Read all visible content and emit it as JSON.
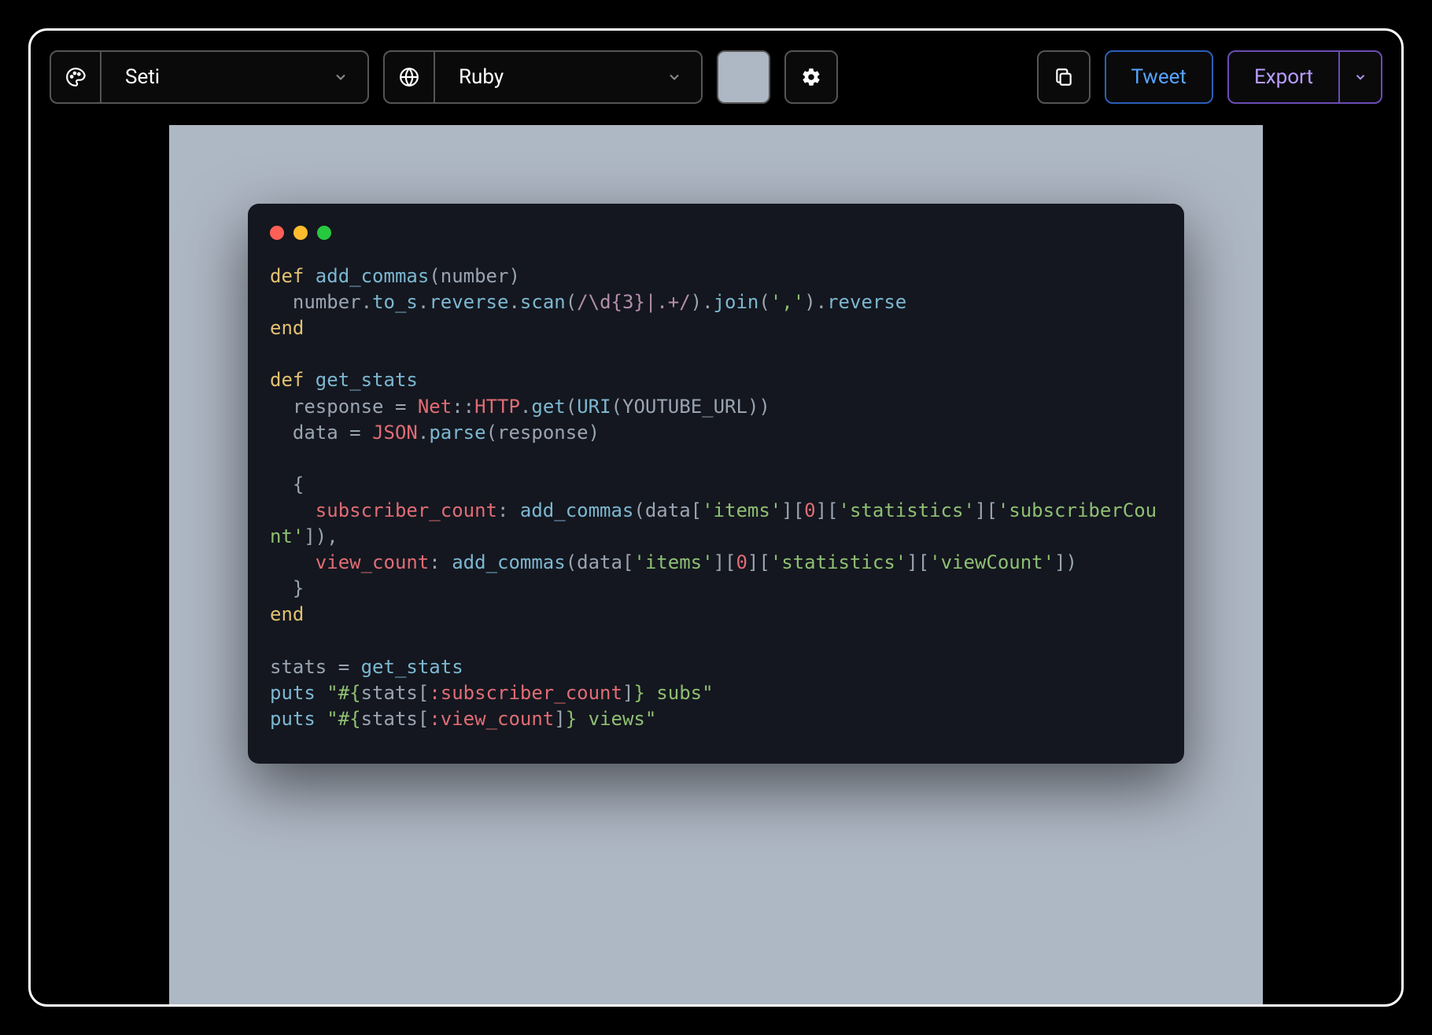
{
  "toolbar": {
    "theme_label": "Seti",
    "language_label": "Ruby",
    "swatch_color": "#aeb7c4",
    "tweet_label": "Tweet",
    "export_label": "Export"
  },
  "window": {
    "traffic_colors": [
      "#ff5f56",
      "#ffbd2e",
      "#27c93f"
    ]
  },
  "code": {
    "tokens": [
      [
        [
          "kw",
          "def "
        ],
        [
          "fn",
          "add_commas"
        ],
        [
          "pun",
          "("
        ],
        [
          "id",
          "number"
        ],
        [
          "pun",
          ")"
        ]
      ],
      [
        [
          "id",
          "  number"
        ],
        [
          "pun",
          "."
        ],
        [
          "call",
          "to_s"
        ],
        [
          "pun",
          "."
        ],
        [
          "call",
          "reverse"
        ],
        [
          "pun",
          "."
        ],
        [
          "call",
          "scan"
        ],
        [
          "pun",
          "("
        ],
        [
          "re",
          "/\\d{3}|.+/"
        ],
        [
          "pun",
          ")."
        ],
        [
          "call",
          "join"
        ],
        [
          "pun",
          "("
        ],
        [
          "str",
          "','"
        ],
        [
          "pun",
          ")."
        ],
        [
          "call",
          "reverse"
        ]
      ],
      [
        [
          "kw",
          "end"
        ]
      ],
      [
        [
          "",
          ""
        ]
      ],
      [
        [
          "kw",
          "def "
        ],
        [
          "fn",
          "get_stats"
        ]
      ],
      [
        [
          "id",
          "  response "
        ],
        [
          "op",
          "= "
        ],
        [
          "cls",
          "Net"
        ],
        [
          "pun",
          "::"
        ],
        [
          "cls",
          "HTTP"
        ],
        [
          "pun",
          "."
        ],
        [
          "call",
          "get"
        ],
        [
          "pun",
          "("
        ],
        [
          "call",
          "URI"
        ],
        [
          "pun",
          "("
        ],
        [
          "const",
          "YOUTUBE_URL"
        ],
        [
          "pun",
          "))"
        ]
      ],
      [
        [
          "id",
          "  data "
        ],
        [
          "op",
          "= "
        ],
        [
          "cls",
          "JSON"
        ],
        [
          "pun",
          "."
        ],
        [
          "call",
          "parse"
        ],
        [
          "pun",
          "("
        ],
        [
          "id",
          "response"
        ],
        [
          "pun",
          ")"
        ]
      ],
      [
        [
          "",
          ""
        ]
      ],
      [
        [
          "pun",
          "  {"
        ]
      ],
      [
        [
          "sym",
          "    subscriber_count"
        ],
        [
          "pun",
          ": "
        ],
        [
          "call",
          "add_commas"
        ],
        [
          "pun",
          "("
        ],
        [
          "id",
          "data"
        ],
        [
          "pun",
          "["
        ],
        [
          "str",
          "'items'"
        ],
        [
          "pun",
          "]["
        ],
        [
          "num",
          "0"
        ],
        [
          "pun",
          "]["
        ],
        [
          "str",
          "'statistics'"
        ],
        [
          "pun",
          "]["
        ],
        [
          "str",
          "'subscriberCount'"
        ],
        [
          "pun",
          "]),"
        ]
      ],
      [
        [
          "sym",
          "    view_count"
        ],
        [
          "pun",
          ": "
        ],
        [
          "call",
          "add_commas"
        ],
        [
          "pun",
          "("
        ],
        [
          "id",
          "data"
        ],
        [
          "pun",
          "["
        ],
        [
          "str",
          "'items'"
        ],
        [
          "pun",
          "]["
        ],
        [
          "num",
          "0"
        ],
        [
          "pun",
          "]["
        ],
        [
          "str",
          "'statistics'"
        ],
        [
          "pun",
          "]["
        ],
        [
          "str",
          "'viewCount'"
        ],
        [
          "pun",
          "])"
        ]
      ],
      [
        [
          "pun",
          "  }"
        ]
      ],
      [
        [
          "kw",
          "end"
        ]
      ],
      [
        [
          "",
          ""
        ]
      ],
      [
        [
          "id",
          "stats "
        ],
        [
          "op",
          "= "
        ],
        [
          "call",
          "get_stats"
        ]
      ],
      [
        [
          "call",
          "puts "
        ],
        [
          "str",
          "\"#{"
        ],
        [
          "id",
          "stats"
        ],
        [
          "pun",
          "["
        ],
        [
          "sym",
          ":subscriber_count"
        ],
        [
          "pun",
          "]"
        ],
        [
          "str",
          "} subs\""
        ]
      ],
      [
        [
          "call",
          "puts "
        ],
        [
          "str",
          "\"#{"
        ],
        [
          "id",
          "stats"
        ],
        [
          "pun",
          "["
        ],
        [
          "sym",
          ":view_count"
        ],
        [
          "pun",
          "]"
        ],
        [
          "str",
          "} views\""
        ]
      ]
    ]
  }
}
